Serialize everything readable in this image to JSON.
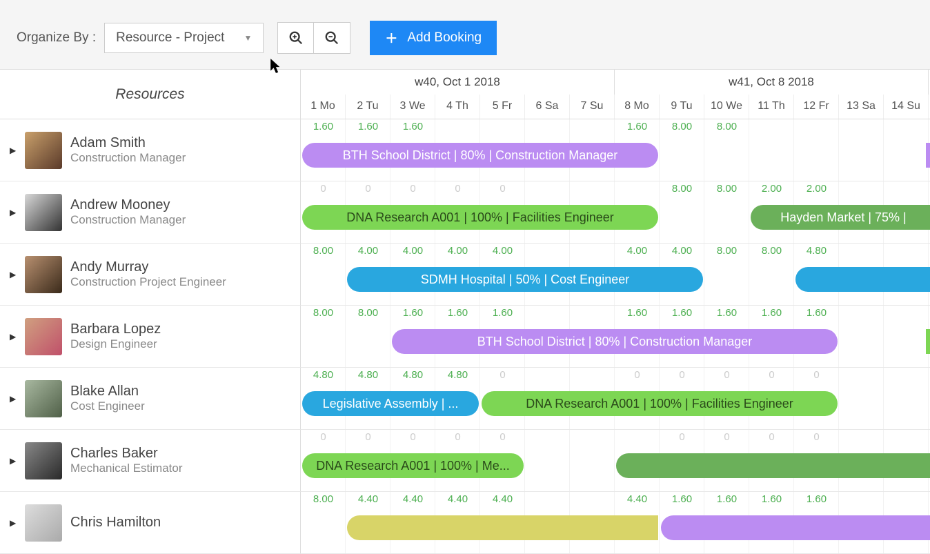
{
  "toolbar": {
    "organize_label": "Organize By :",
    "dropdown_value": "Resource - Project",
    "add_booking_label": "Add Booking"
  },
  "timeline": {
    "weeks": [
      {
        "label": "w40, Oct 1 2018",
        "span": 7
      },
      {
        "label": "w41, Oct 8 2018",
        "span": 7
      }
    ],
    "days": [
      "1 Mo",
      "2 Tu",
      "3 We",
      "4 Th",
      "5 Fr",
      "6 Sa",
      "7 Su",
      "8 Mo",
      "9 Tu",
      "10 We",
      "11 Th",
      "12 Fr",
      "13 Sa",
      "14 Su"
    ],
    "resources_header": "Resources"
  },
  "resources": [
    {
      "name": "Adam Smith",
      "role": "Construction Manager",
      "avatar": "a1",
      "hours": [
        "1.60",
        "1.60",
        "1.60",
        "",
        "",
        "",
        "",
        "1.60",
        "8.00",
        "8.00",
        "",
        "",
        "",
        ""
      ],
      "hour_colors": [
        "green",
        "green",
        "green",
        "",
        "",
        "",
        "",
        "green",
        "green",
        "green",
        "",
        "",
        "",
        ""
      ],
      "bookings": [
        {
          "label": "BTH School District | 80% | Construction Manager",
          "start": 0,
          "span": 8,
          "color": "purple"
        },
        {
          "label": "",
          "start": 13.9,
          "span": 0.3,
          "color": "purple",
          "leftflat": true,
          "rightflat": true
        }
      ]
    },
    {
      "name": "Andrew Mooney",
      "role": "Construction Manager",
      "avatar": "a2",
      "hours": [
        "0",
        "0",
        "0",
        "0",
        "0",
        "",
        "",
        "",
        "8.00",
        "8.00",
        "2.00",
        "2.00",
        "",
        ""
      ],
      "hour_colors": [
        "gray",
        "gray",
        "gray",
        "gray",
        "gray",
        "",
        "",
        "",
        "green",
        "green",
        "green",
        "green",
        "",
        ""
      ],
      "bookings": [
        {
          "label": "DNA Research A001 | 100% | Facilities Engineer",
          "start": 0,
          "span": 8,
          "color": "green"
        },
        {
          "label": "Hayden Market | 75% |",
          "start": 10,
          "span": 4.2,
          "color": "darkgreen",
          "rightflat": true
        }
      ]
    },
    {
      "name": "Andy Murray",
      "role": "Construction Project Engineer",
      "avatar": "a3",
      "hours": [
        "8.00",
        "4.00",
        "4.00",
        "4.00",
        "4.00",
        "",
        "",
        "4.00",
        "4.00",
        "8.00",
        "8.00",
        "4.80",
        "",
        ""
      ],
      "hour_colors": [
        "green",
        "green",
        "green",
        "green",
        "green",
        "",
        "",
        "green",
        "green",
        "green",
        "green",
        "green",
        "",
        ""
      ],
      "bookings": [
        {
          "label": "SDMH Hospital | 50% | Cost Engineer",
          "start": 1,
          "span": 8,
          "color": "blue"
        },
        {
          "label": "",
          "start": 11,
          "span": 3.2,
          "color": "blue",
          "rightflat": true
        }
      ]
    },
    {
      "name": "Barbara Lopez",
      "role": "Design Engineer",
      "avatar": "a4",
      "hours": [
        "8.00",
        "8.00",
        "1.60",
        "1.60",
        "1.60",
        "",
        "",
        "1.60",
        "1.60",
        "1.60",
        "1.60",
        "1.60",
        "",
        ""
      ],
      "hour_colors": [
        "green",
        "green",
        "green",
        "green",
        "green",
        "",
        "",
        "green",
        "green",
        "green",
        "green",
        "green",
        "",
        ""
      ],
      "bookings": [
        {
          "label": "BTH School District | 80% | Construction Manager",
          "start": 2,
          "span": 10,
          "color": "purple"
        },
        {
          "label": "",
          "start": 13.9,
          "span": 0.3,
          "color": "green",
          "leftflat": true,
          "rightflat": true
        }
      ]
    },
    {
      "name": "Blake Allan",
      "role": "Cost Engineer",
      "avatar": "a5",
      "hours": [
        "4.80",
        "4.80",
        "4.80",
        "4.80",
        "0",
        "",
        "",
        "0",
        "0",
        "0",
        "0",
        "0",
        "",
        ""
      ],
      "hour_colors": [
        "green",
        "green",
        "green",
        "green",
        "gray",
        "",
        "",
        "gray",
        "gray",
        "gray",
        "gray",
        "gray",
        "",
        ""
      ],
      "bookings": [
        {
          "label": "Legislative Assembly | ...",
          "start": 0,
          "span": 4,
          "color": "blue"
        },
        {
          "label": "DNA Research A001 | 100% | Facilities Engineer",
          "start": 4,
          "span": 8,
          "color": "green"
        }
      ]
    },
    {
      "name": "Charles Baker",
      "role": "Mechanical Estimator",
      "avatar": "a6",
      "hours": [
        "0",
        "0",
        "0",
        "0",
        "0",
        "",
        "",
        "",
        "0",
        "0",
        "0",
        "0",
        "",
        ""
      ],
      "hour_colors": [
        "gray",
        "gray",
        "gray",
        "gray",
        "gray",
        "",
        "",
        "",
        "gray",
        "gray",
        "gray",
        "gray",
        "",
        ""
      ],
      "bookings": [
        {
          "label": "DNA Research A001 | 100% | Me...",
          "start": 0,
          "span": 5,
          "color": "green"
        },
        {
          "label": "",
          "start": 7,
          "span": 7.2,
          "color": "darkgreen",
          "rightflat": true
        }
      ]
    },
    {
      "name": "Chris Hamilton",
      "role": "",
      "avatar": "a7",
      "hours": [
        "8.00",
        "4.40",
        "4.40",
        "4.40",
        "4.40",
        "",
        "",
        "4.40",
        "1.60",
        "1.60",
        "1.60",
        "1.60",
        "",
        ""
      ],
      "hour_colors": [
        "green",
        "green",
        "green",
        "green",
        "green",
        "",
        "",
        "green",
        "green",
        "green",
        "green",
        "green",
        "",
        ""
      ],
      "bookings": [
        {
          "label": "",
          "start": 1,
          "span": 7,
          "color": "yellow",
          "rightflat": true
        },
        {
          "label": "",
          "start": 8,
          "span": 6.2,
          "color": "purple",
          "rightflat": true
        }
      ]
    }
  ]
}
